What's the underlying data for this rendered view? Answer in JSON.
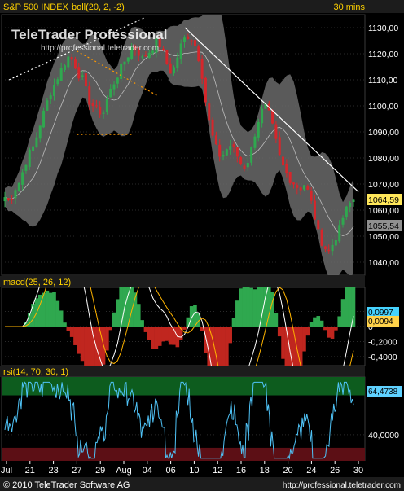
{
  "header": {
    "title": "S&P 500 INDEX",
    "indicator": "boll(20, 2, -2)",
    "timeframe": "30 mins"
  },
  "watermark": {
    "brand": "TeleTrader Professional",
    "url": "http://professional.teletrader.com"
  },
  "footer": {
    "copyright": "© 2010 TeleTrader Software AG",
    "url": "http://professional.teletrader.com"
  },
  "colors": {
    "background": "#000000",
    "header_bg": "#1c1c1c",
    "title_text": "#ffd200",
    "band_fill": "#6a6a6a",
    "up_candle": "#2fa84f",
    "down_candle": "#d6262b",
    "trend_line": "#f2f2f2",
    "dotted_orange": "#ff9900",
    "macd_line": "#ffffff",
    "signal_line": "#ffb400",
    "hist_pos": "#2fa84f",
    "hist_neg": "#c0261f",
    "rsi_line": "#4fc3f7",
    "rsi_overbought": "#0d5c1e",
    "rsi_oversold": "#5c0f15",
    "price_badge": "#ffe75a",
    "lower_badge": "#909090",
    "macd_badge": "#46d3ff",
    "signal_badge": "#ffd24a",
    "rsi_badge": "#5fd1ff"
  },
  "chart_data": [
    {
      "type": "candlestick",
      "ylim": [
        1035,
        1135
      ],
      "yticks": [
        "1040,00",
        "1050,00",
        "1060,00",
        "1070,00",
        "1080,00",
        "1090,00",
        "1100,00",
        "1110,00",
        "1120,00",
        "1130,00"
      ],
      "yvalues": [
        1040,
        1050,
        1060,
        1070,
        1080,
        1090,
        1100,
        1110,
        1120,
        1130
      ],
      "x_labels": [
        "Jul",
        "21",
        "23",
        "27",
        "29",
        "Aug",
        "04",
        "06",
        "10",
        "12",
        "16",
        "18",
        "20",
        "24",
        "26",
        "30"
      ],
      "last_close": "1064,59",
      "lower_band_last": "1055,54",
      "close_path": [
        [
          0,
          1065
        ],
        [
          6,
          1063
        ],
        [
          12,
          1068
        ],
        [
          18,
          1071
        ],
        [
          24,
          1077
        ],
        [
          30,
          1082
        ],
        [
          36,
          1085
        ],
        [
          42,
          1092
        ],
        [
          48,
          1098
        ],
        [
          54,
          1104
        ],
        [
          60,
          1108
        ],
        [
          66,
          1112
        ],
        [
          72,
          1116
        ],
        [
          78,
          1119
        ],
        [
          84,
          1117
        ],
        [
          90,
          1112
        ],
        [
          96,
          1110
        ],
        [
          102,
          1102
        ],
        [
          108,
          1100
        ],
        [
          114,
          1098
        ],
        [
          120,
          1097
        ],
        [
          126,
          1104
        ],
        [
          132,
          1108
        ],
        [
          138,
          1112
        ],
        [
          144,
          1116
        ],
        [
          150,
          1119
        ],
        [
          156,
          1123
        ],
        [
          162,
          1121
        ],
        [
          168,
          1118
        ],
        [
          174,
          1120
        ],
        [
          180,
          1122
        ],
        [
          186,
          1125
        ],
        [
          192,
          1122
        ],
        [
          198,
          1116
        ],
        [
          204,
          1112
        ],
        [
          210,
          1118
        ],
        [
          216,
          1124
        ],
        [
          222,
          1127
        ],
        [
          228,
          1126
        ],
        [
          234,
          1122
        ],
        [
          240,
          1114
        ],
        [
          246,
          1100
        ],
        [
          252,
          1090
        ],
        [
          258,
          1084
        ],
        [
          264,
          1080
        ],
        [
          270,
          1083
        ],
        [
          276,
          1085
        ],
        [
          282,
          1082
        ],
        [
          288,
          1078
        ],
        [
          294,
          1076
        ],
        [
          300,
          1082
        ],
        [
          306,
          1090
        ],
        [
          312,
          1097
        ],
        [
          318,
          1100
        ],
        [
          324,
          1096
        ],
        [
          330,
          1088
        ],
        [
          336,
          1080
        ],
        [
          342,
          1075
        ],
        [
          348,
          1072
        ],
        [
          354,
          1070
        ],
        [
          360,
          1068
        ],
        [
          366,
          1070
        ],
        [
          372,
          1066
        ],
        [
          378,
          1058
        ],
        [
          384,
          1050
        ],
        [
          390,
          1046
        ],
        [
          396,
          1044
        ],
        [
          402,
          1048
        ],
        [
          408,
          1052
        ],
        [
          414,
          1058
        ],
        [
          420,
          1062
        ],
        [
          426,
          1064
        ]
      ],
      "trend_lines": [
        {
          "from": [
            5,
            1110
          ],
          "to": [
            172,
            1134
          ],
          "style": "dotted",
          "color": "#ffffff"
        },
        {
          "from": [
            88,
            1121
          ],
          "to": [
            186,
            1104
          ],
          "style": "dotted",
          "color": "#ff9900"
        },
        {
          "from": [
            88,
            1089
          ],
          "to": [
            155,
            1089
          ],
          "style": "dotted",
          "color": "#ff9900"
        },
        {
          "from": [
            220,
            1130
          ],
          "to": [
            432,
            1067
          ],
          "style": "solid",
          "color": "#ffffff"
        }
      ]
    },
    {
      "type": "macd",
      "label": "macd(25, 26, 12)",
      "ylim": [
        -0.52,
        0.52
      ],
      "yticks": [
        "0,2000",
        "0",
        "-0,2000",
        "-0,4000"
      ],
      "yvalues": [
        0.2,
        0,
        -0.2,
        -0.4
      ],
      "macd_last": "0,0997",
      "signal_last": "0,0094"
    },
    {
      "type": "line",
      "label": "rsi(14, 70, 30, 1)",
      "ylim": [
        20,
        84
      ],
      "yticks": [
        "40,0000"
      ],
      "yvalues": [
        40
      ],
      "overbought": 70,
      "oversold": 30,
      "last": "64,4738"
    }
  ]
}
